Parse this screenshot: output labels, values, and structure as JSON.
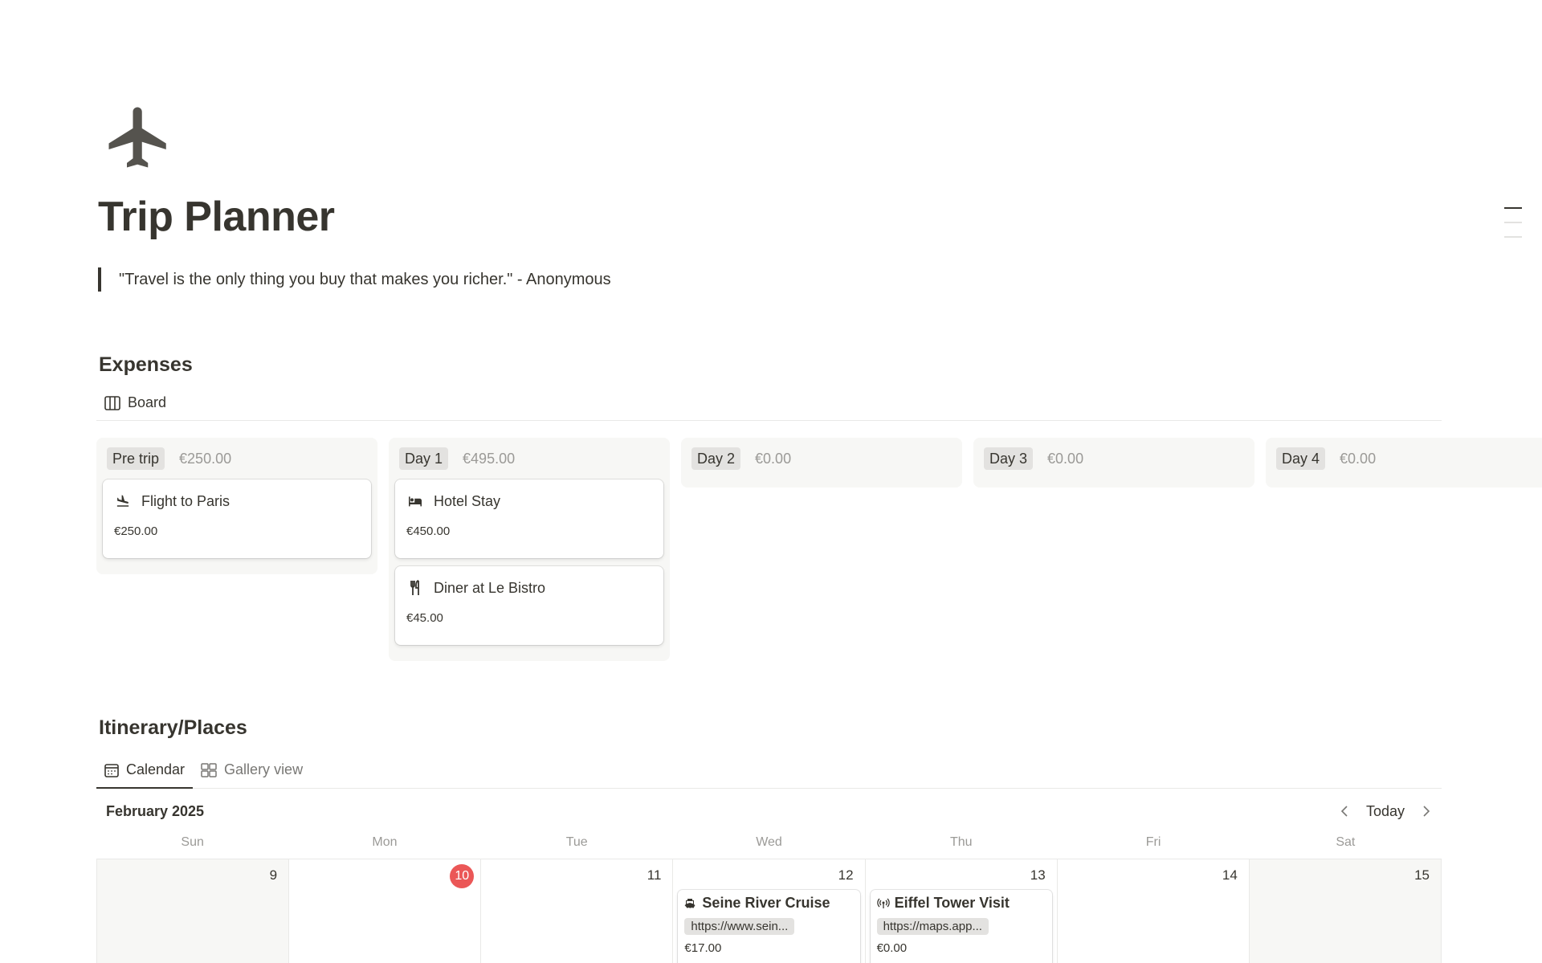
{
  "page": {
    "icon": "airplane-icon",
    "title": "Trip Planner",
    "quote": "\"Travel is the only thing you buy that makes you richer.\" - Anonymous"
  },
  "expenses": {
    "title": "Expenses",
    "view_tab": {
      "label": "Board",
      "icon": "board-icon"
    },
    "columns": [
      {
        "tag": "Pre trip",
        "sum": "€250.00",
        "cards": [
          {
            "title": "Flight to Paris",
            "amount": "€250.00",
            "icon": "plane-landing-icon"
          }
        ]
      },
      {
        "tag": "Day 1",
        "sum": "€495.00",
        "cards": [
          {
            "title": "Hotel Stay",
            "amount": "€450.00",
            "icon": "bed-icon"
          },
          {
            "title": "Diner at Le Bistro",
            "amount": "€45.00",
            "icon": "fork-knife-icon"
          }
        ]
      },
      {
        "tag": "Day 2",
        "sum": "€0.00",
        "cards": []
      },
      {
        "tag": "Day 3",
        "sum": "€0.00",
        "cards": []
      },
      {
        "tag": "Day 4",
        "sum": "€0.00",
        "cards": []
      }
    ]
  },
  "itinerary": {
    "title": "Itinerary/Places",
    "tabs": [
      {
        "label": "Calendar",
        "icon": "calendar-icon",
        "active": true
      },
      {
        "label": "Gallery view",
        "icon": "gallery-icon",
        "active": false
      }
    ],
    "calendar": {
      "month": "February 2025",
      "today_label": "Today",
      "weekdays": [
        "Sun",
        "Mon",
        "Tue",
        "Wed",
        "Thu",
        "Fri",
        "Sat"
      ],
      "days": [
        "9",
        "10",
        "11",
        "12",
        "13",
        "14",
        "15"
      ],
      "events": {
        "wed": {
          "title": "Seine River Cruise",
          "link": "https://www.sein...",
          "amount": "€17.00",
          "icon": "ship-icon"
        },
        "thu": {
          "title": "Eiffel Tower Visit",
          "link": "https://maps.app...",
          "amount": "€0.00",
          "icon": "broadcast-icon"
        }
      }
    }
  },
  "colors": {
    "today": "#eb5757",
    "text": "#37352f",
    "muted": "#9b9a97"
  }
}
